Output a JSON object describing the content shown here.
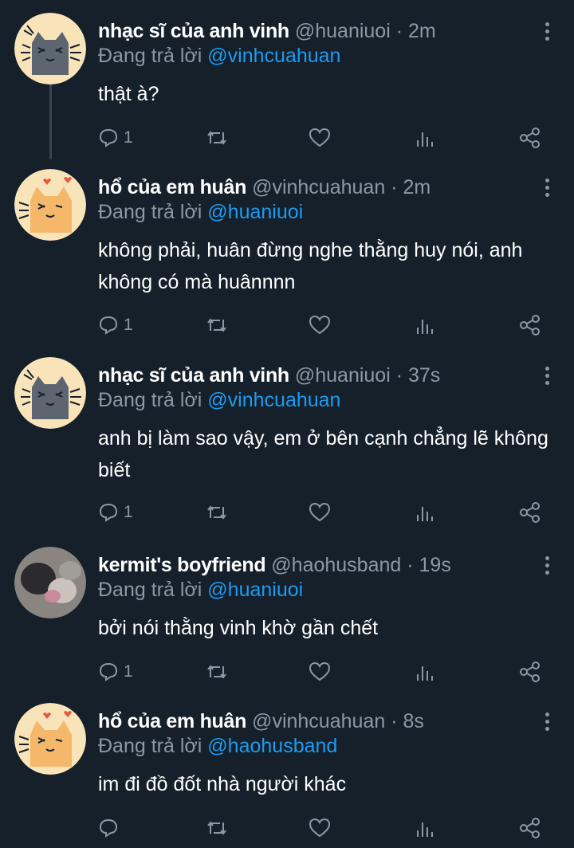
{
  "tweets": [
    {
      "name": "nhạc sĩ của anh vinh",
      "handle": "@huaniuoi",
      "time": "2m",
      "reply_prefix": "Đang trả lời",
      "reply_to": "@vinhcuahuan",
      "text": "thật à?",
      "reply_count": "1",
      "avatar": "cat-avatar-gray"
    },
    {
      "name": "hổ của em huân",
      "handle": "@vinhcuahuan",
      "time": "2m",
      "reply_prefix": "Đang trả lời",
      "reply_to": "@huaniuoi",
      "text": "không phải, huân đừng nghe thằng huy nói, anh không có mà huânnnn",
      "reply_count": "1",
      "avatar": "cat-avatar-orange"
    },
    {
      "name": "nhạc sĩ của anh vinh",
      "handle": "@huaniuoi",
      "time": "37s",
      "reply_prefix": "Đang trả lời",
      "reply_to": "@vinhcuahuan",
      "text": "anh bị làm sao vậy, em ở bên cạnh chẳng lẽ không biết",
      "reply_count": "1",
      "avatar": "cat-avatar-gray"
    },
    {
      "name": "kermit's boyfriend",
      "handle": "@haohusband",
      "time": "19s",
      "reply_prefix": "Đang trả lời",
      "reply_to": "@huaniuoi",
      "text": "bởi nói thằng vinh khờ gần chết",
      "reply_count": "1",
      "avatar": "photo-avatar"
    },
    {
      "name": "hổ của em huân",
      "handle": "@vinhcuahuan",
      "time": "8s",
      "reply_prefix": "Đang trả lời",
      "reply_to": "@haohusband",
      "text": "im đi đồ đốt nhà người khác",
      "reply_count": "",
      "avatar": "cat-avatar-orange"
    }
  ],
  "colors": {
    "background": "#15202b",
    "muted": "#8b98a5",
    "link": "#1d9bf0",
    "avatar_bg": "#f9e3b9"
  },
  "icons": [
    "reply-icon",
    "retweet-icon",
    "like-icon",
    "analytics-icon",
    "share-icon",
    "more-icon"
  ]
}
